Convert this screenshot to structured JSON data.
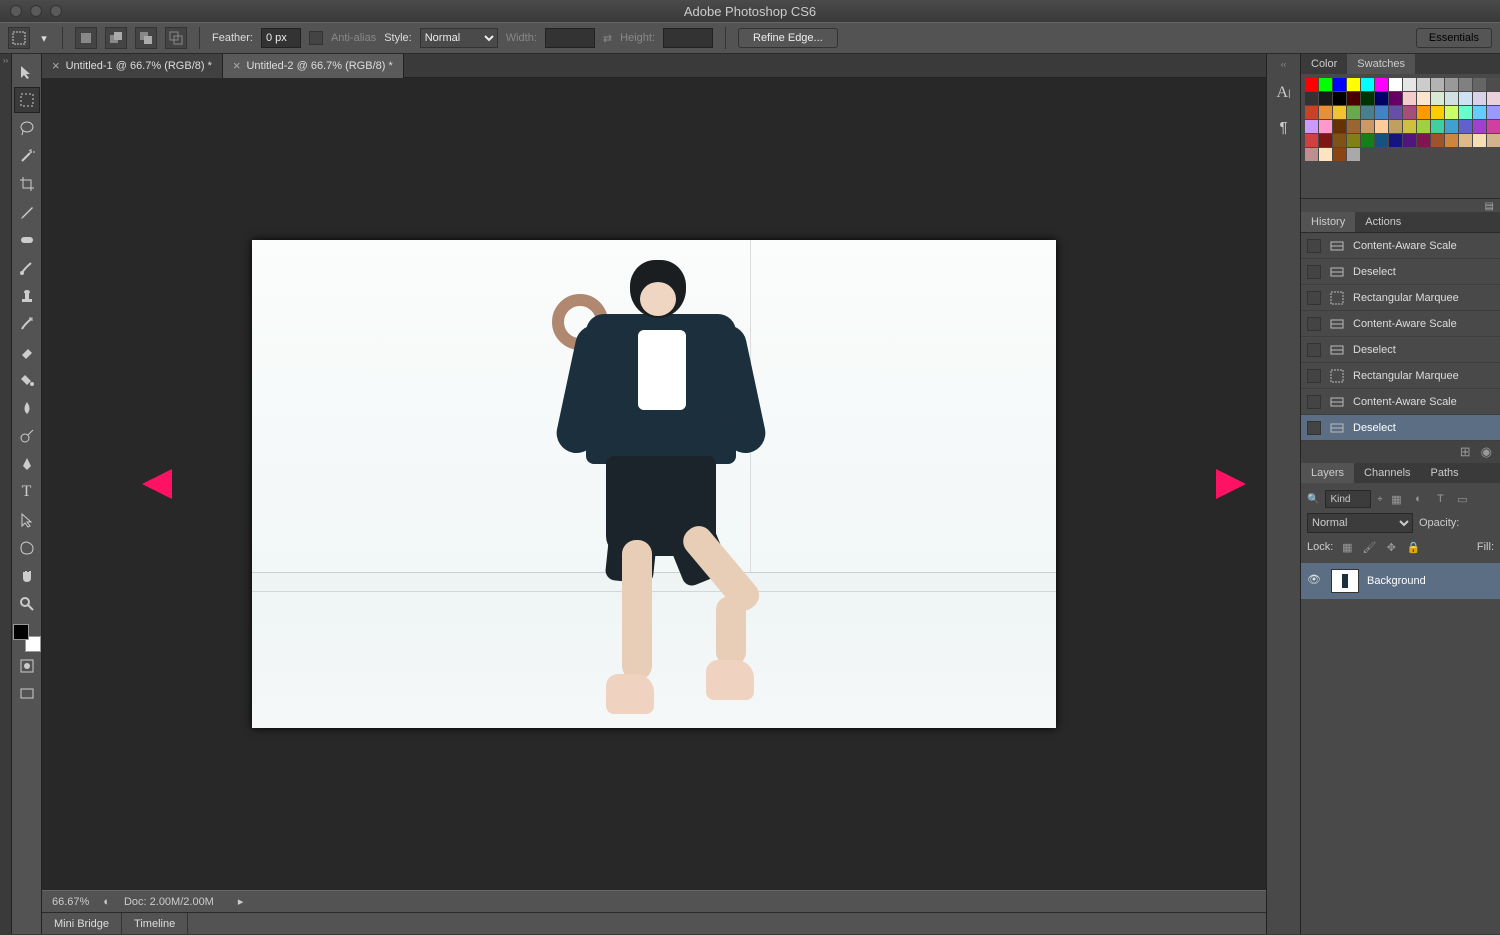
{
  "titlebar": {
    "title": "Adobe Photoshop CS6"
  },
  "optbar": {
    "feather_label": "Feather:",
    "feather_value": "0 px",
    "antialias_label": "Anti-alias",
    "style_label": "Style:",
    "style_value": "Normal",
    "width_label": "Width:",
    "height_label": "Height:",
    "refine_label": "Refine Edge...",
    "essentials_label": "Essentials"
  },
  "doctabs": [
    {
      "label": "Untitled-1 @ 66.7% (RGB/8) *",
      "active": false
    },
    {
      "label": "Untitled-2 @ 66.7% (RGB/8) *",
      "active": true
    }
  ],
  "status": {
    "zoom": "66.67%",
    "doc": "Doc: 2.00M/2.00M"
  },
  "bottomtabs": {
    "minibridge": "Mini Bridge",
    "timeline": "Timeline"
  },
  "rightstrip": {
    "char_icon": "A",
    "para_icon": "¶"
  },
  "panel_color": {
    "color_tab": "Color",
    "swatches_tab": "Swatches"
  },
  "swatch_colors": [
    "#ff0000",
    "#00ff00",
    "#0000ff",
    "#ffff00",
    "#00ffff",
    "#ff00ff",
    "#ffffff",
    "#e6e6e6",
    "#cccccc",
    "#b3b3b3",
    "#999999",
    "#808080",
    "#666666",
    "#4d4d4d",
    "#333333",
    "#1a1a1a",
    "#000000",
    "#4b0000",
    "#003300",
    "#000066",
    "#660066",
    "#f4cccc",
    "#fce5cd",
    "#d9ead3",
    "#d0e0e3",
    "#cfe2f3",
    "#d9d2e9",
    "#ead1dc",
    "#cc4125",
    "#e69138",
    "#f1c232",
    "#6aa84f",
    "#45818e",
    "#3d85c6",
    "#674ea7",
    "#a64d79",
    "#ff9900",
    "#ffcc00",
    "#ccff66",
    "#66ffcc",
    "#66ccff",
    "#9999ff",
    "#cc99ff",
    "#ff99cc",
    "#663300",
    "#996633",
    "#cc9966",
    "#ffcc99",
    "#c0a060",
    "#d0c040",
    "#a0d040",
    "#40d0a0",
    "#40a0d0",
    "#6060d0",
    "#a040d0",
    "#d040a0",
    "#d04040",
    "#801515",
    "#805215",
    "#808015",
    "#158015",
    "#155280",
    "#151580",
    "#521580",
    "#801552",
    "#a0522d",
    "#cd853f",
    "#deb887",
    "#f5deb3",
    "#d2b48c",
    "#bc8f8f",
    "#ffe4c4",
    "#8b4513",
    "#a9a9a9"
  ],
  "panel_history": {
    "history_tab": "History",
    "actions_tab": "Actions"
  },
  "history": [
    {
      "label": "Content-Aware Scale",
      "icon": "scale"
    },
    {
      "label": "Deselect",
      "icon": "scale"
    },
    {
      "label": "Rectangular Marquee",
      "icon": "marquee"
    },
    {
      "label": "Content-Aware Scale",
      "icon": "scale"
    },
    {
      "label": "Deselect",
      "icon": "scale"
    },
    {
      "label": "Rectangular Marquee",
      "icon": "marquee"
    },
    {
      "label": "Content-Aware Scale",
      "icon": "scale"
    },
    {
      "label": "Deselect",
      "icon": "scale",
      "selected": true
    }
  ],
  "panel_layers": {
    "layers_tab": "Layers",
    "channels_tab": "Channels",
    "paths_tab": "Paths"
  },
  "layers": {
    "kind_label": "Kind",
    "blend_mode": "Normal",
    "opacity_label": "Opacity:",
    "lock_label": "Lock:",
    "fill_label": "Fill:",
    "items": [
      {
        "name": "Background"
      }
    ]
  }
}
